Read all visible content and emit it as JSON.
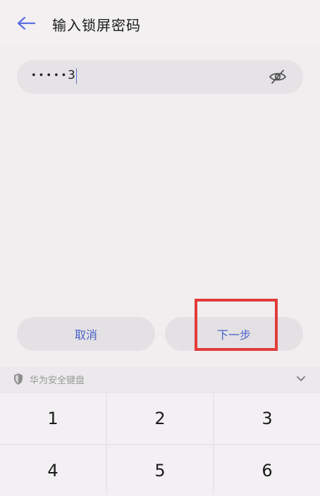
{
  "header": {
    "title": "输入锁屏密码",
    "back_label": "back-arrow"
  },
  "password": {
    "masked": "•••••",
    "typed": "3",
    "visibility_icon": "eye-off-icon"
  },
  "actions": {
    "cancel_label": "取消",
    "next_label": "下一步"
  },
  "keyboard": {
    "header_label": "华为安全键盘",
    "keys": [
      "1",
      "2",
      "3",
      "4",
      "5",
      "6"
    ]
  },
  "colors": {
    "accent": "#4a61c9",
    "highlight": "#e23b3b"
  }
}
